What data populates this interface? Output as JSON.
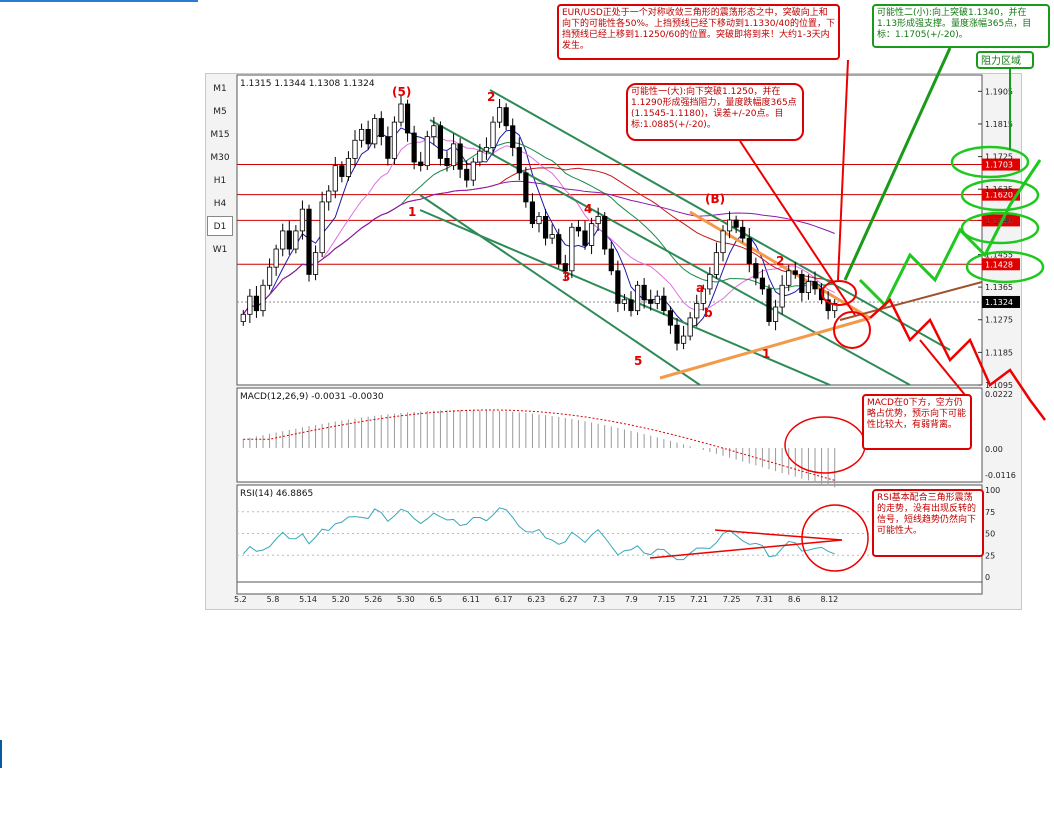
{
  "chart_data": [
    {
      "type": "candlestick",
      "symbol": "EUR/USD",
      "ohlc_header": "1.1315 1.1344 1.1308 1.1324",
      "ylim": [
        1.1095,
        1.195
      ],
      "y_ticks": [
        "1.1905",
        "1.1815",
        "1.1725",
        "1.1635",
        "1.1549",
        "1.1455",
        "1.1365",
        "1.1275",
        "1.1185",
        "1.1095"
      ],
      "price_levels": [
        {
          "label": "1.1703",
          "value": 1.1703
        },
        {
          "label": "1.1620",
          "value": 1.162
        },
        {
          "label": "1.1549",
          "value": 1.1549
        },
        {
          "label": "1.1428",
          "value": 1.1428
        }
      ],
      "current_price": "1.1324",
      "x_ticks": [
        "5.2",
        "5.8",
        "5.14",
        "5.20",
        "5.26",
        "5.30",
        "6.5",
        "6.11",
        "6.17",
        "6.23",
        "6.27",
        "7.3",
        "7.9",
        "7.15",
        "7.21",
        "7.25",
        "7.31",
        "8.6",
        "8.12"
      ],
      "closes": [
        1.129,
        1.134,
        1.13,
        1.137,
        1.142,
        1.147,
        1.152,
        1.147,
        1.152,
        1.158,
        1.14,
        1.146,
        1.16,
        1.163,
        1.17,
        1.167,
        1.172,
        1.177,
        1.18,
        1.176,
        1.183,
        1.178,
        1.172,
        1.182,
        1.187,
        1.179,
        1.171,
        1.17,
        1.178,
        1.181,
        1.172,
        1.17,
        1.176,
        1.169,
        1.166,
        1.171,
        1.174,
        1.175,
        1.182,
        1.186,
        1.181,
        1.175,
        1.168,
        1.16,
        1.154,
        1.156,
        1.15,
        1.151,
        1.143,
        1.141,
        1.153,
        1.152,
        1.148,
        1.154,
        1.156,
        1.147,
        1.141,
        1.132,
        1.133,
        1.13,
        1.137,
        1.133,
        1.132,
        1.134,
        1.13,
        1.126,
        1.121,
        1.123,
        1.128,
        1.132,
        1.136,
        1.14,
        1.146,
        1.152,
        1.155,
        1.153,
        1.15,
        1.143,
        1.139,
        1.136,
        1.127,
        1.131,
        1.137,
        1.141,
        1.14,
        1.135,
        1.138,
        1.136,
        1.133,
        1.13,
        1.132
      ],
      "wave_labels": [
        "(5)",
        "2",
        "1",
        "4",
        "3",
        "(B)",
        "a",
        "b",
        "2",
        "5",
        "1"
      ]
    },
    {
      "type": "line",
      "name": "MACD(12,26,9)",
      "header": "MACD(12,26,9)  -0.0031 -0.0030",
      "y_ticks": [
        "0.0222",
        "0.00",
        "-0.0116"
      ]
    },
    {
      "type": "line",
      "name": "RSI(14)",
      "header": "RSI(14) 46.8865",
      "y_ticks": [
        "100",
        "75",
        "50",
        "25",
        "0"
      ]
    }
  ],
  "timeframes": [
    "M1",
    "M5",
    "M15",
    "M30",
    "H1",
    "H4",
    "D1",
    "W1"
  ],
  "active_timeframe": "D1",
  "annotations": {
    "main": "EUR/USD正处于一个对称收敛三角形的震荡形态之中，突破向上和向下的可能性各50%。上挡预线已经下移动到1.1330/40的位置，下挡预线已经上移到1.1250/60的位置。突破即将到来！大约1-3天内发生。",
    "scenario_down": "可能性一(大):向下突破1.1250，并在1.1290形成强挡阻力，量度跌幅度365点(1.1545-1.1180)，误差+/-20点。目标:1.0885(+/-20)。",
    "scenario_up": "可能性二(小):向上突破1.1340，并在1.13形成强支撑。量度涨幅365点，目标：1.1705(+/-20)。",
    "resistance_zone": "阻力区域",
    "macd_note": "MACD在0下方，空方仍略占优势，预示向下可能性比较大，有弱背离。",
    "rsi_note": "RSI基本配合三角形震荡的走势，没有出现反转的信号，短线趋势仍然向下可能性大。"
  },
  "colors": {
    "annotation_red": "#dd0000",
    "annotation_green": "#1a9a1a",
    "level_red": "#cc0000",
    "trend_orange": "#f39a4a",
    "channel_green": "#2e8b57"
  }
}
